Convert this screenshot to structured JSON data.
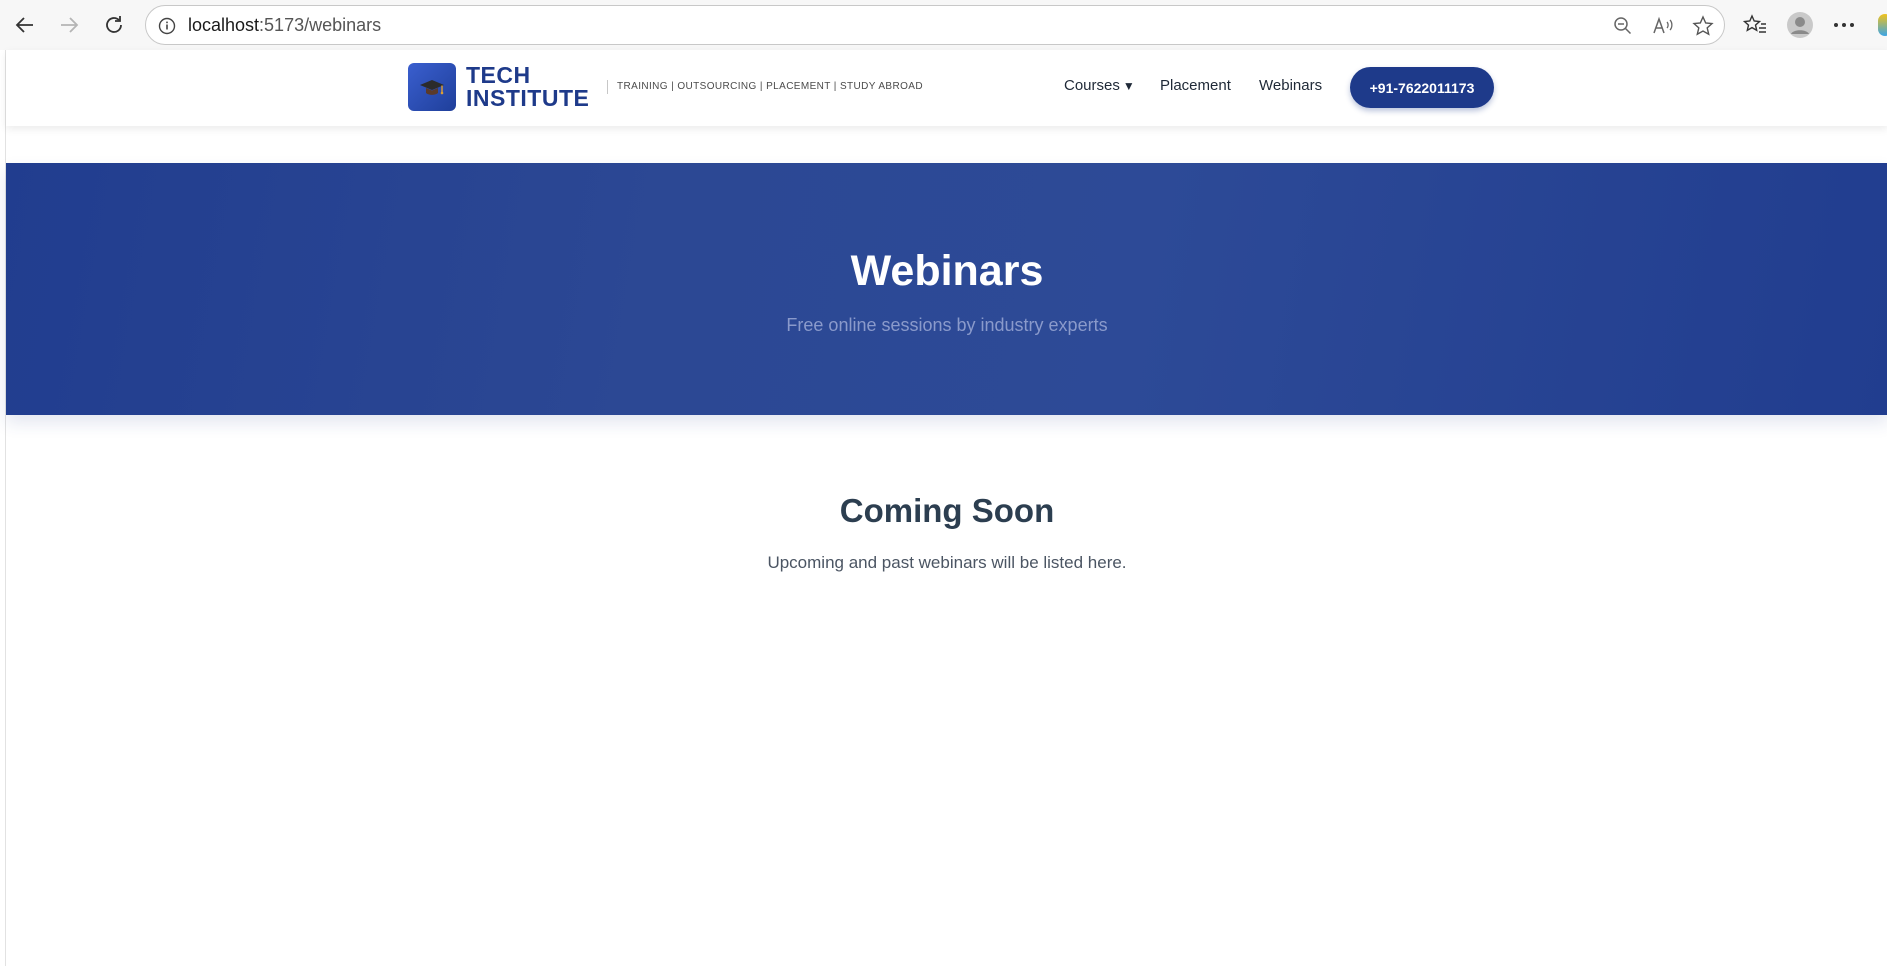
{
  "browser": {
    "url_host": "localhost",
    "url_rest": ":5173/webinars"
  },
  "header": {
    "brand_line1": "TECH",
    "brand_line2": "INSTITUTE",
    "tagline": "TRAINING | OUTSOURCING | PLACEMENT | STUDY ABROAD",
    "nav": {
      "courses": "Courses",
      "placement": "Placement",
      "webinars": "Webinars"
    },
    "phone": "+91-7622011173"
  },
  "hero": {
    "title": "Webinars",
    "subtitle": "Free online sessions by industry experts"
  },
  "content": {
    "title": "Coming Soon",
    "text": "Upcoming and past webinars will be listed here."
  },
  "colors": {
    "brand": "#1e3a8a",
    "hero": "#2c4894"
  }
}
